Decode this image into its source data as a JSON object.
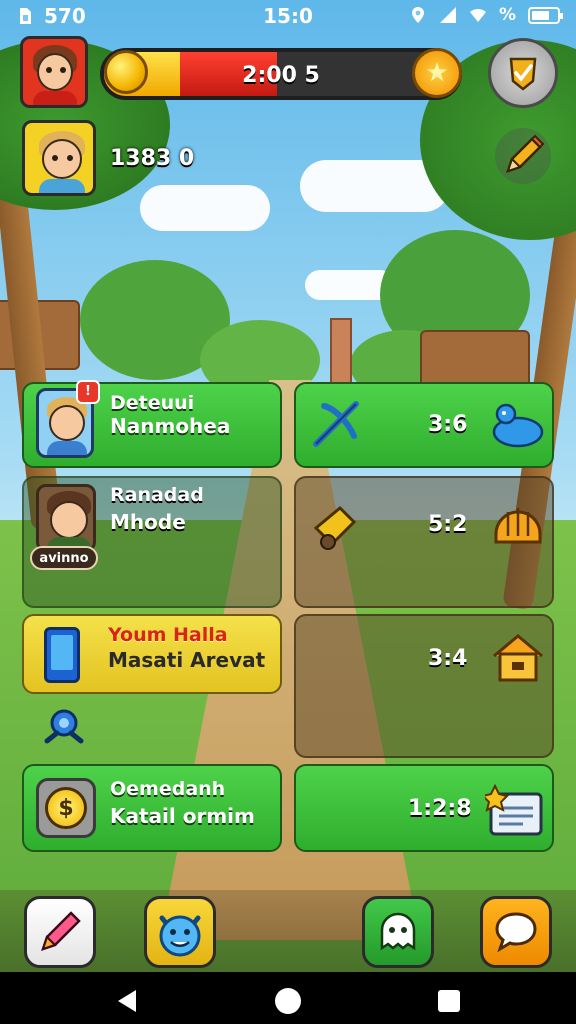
{
  "status_bar": {
    "left_text": "570",
    "time": "15:0",
    "right_text": "%"
  },
  "hud": {
    "progress_value": "2:00 5",
    "progress_fraction": 0.49,
    "score": "1383 0"
  },
  "cards": [
    {
      "line1": "Deteuui",
      "line2": "Nanmohea",
      "badge": "!"
    },
    {
      "value": "3:6"
    },
    {
      "line1": "Ranadad",
      "line2": "Mhode",
      "name_tag": "avinno"
    },
    {
      "value": "5:2"
    },
    {
      "line1": "Youm Halla",
      "line2": "Masati Arevat"
    },
    {
      "value": "3:4"
    },
    {
      "line1": "Oemedanh",
      "line2": "Katail ormim"
    },
    {
      "value": "1:2:8"
    }
  ],
  "icons": {
    "status_left": "sim-icon",
    "status_right": [
      "location-icon",
      "signal-icon",
      "wifi-icon",
      "battery-icon"
    ],
    "hud": [
      "player-avatar-icon",
      "gold-coin-icon",
      "star-badge-icon",
      "check-shield-icon",
      "friend-avatar-icon",
      "pencil-icon"
    ],
    "cards": [
      "friend-avatar-icon",
      "bird-icon",
      "crossbow-icon",
      "friend-avatar-icon",
      "cannon-icon",
      "helmet-icon",
      "tablet-icon",
      "house-icon",
      "gear-icon",
      "coin-icon",
      "document-icon"
    ],
    "bottom": [
      "pencil-icon",
      "cat-face-icon",
      "ghost-icon",
      "chat-bubble-icon"
    ],
    "nav": [
      "back-icon",
      "home-icon",
      "recents-icon"
    ]
  },
  "colors": {
    "card_green": "#3dc23a",
    "card_yellow": "#efd636",
    "progress_red": "#e0281c",
    "progress_yellow": "#f6c71e"
  }
}
